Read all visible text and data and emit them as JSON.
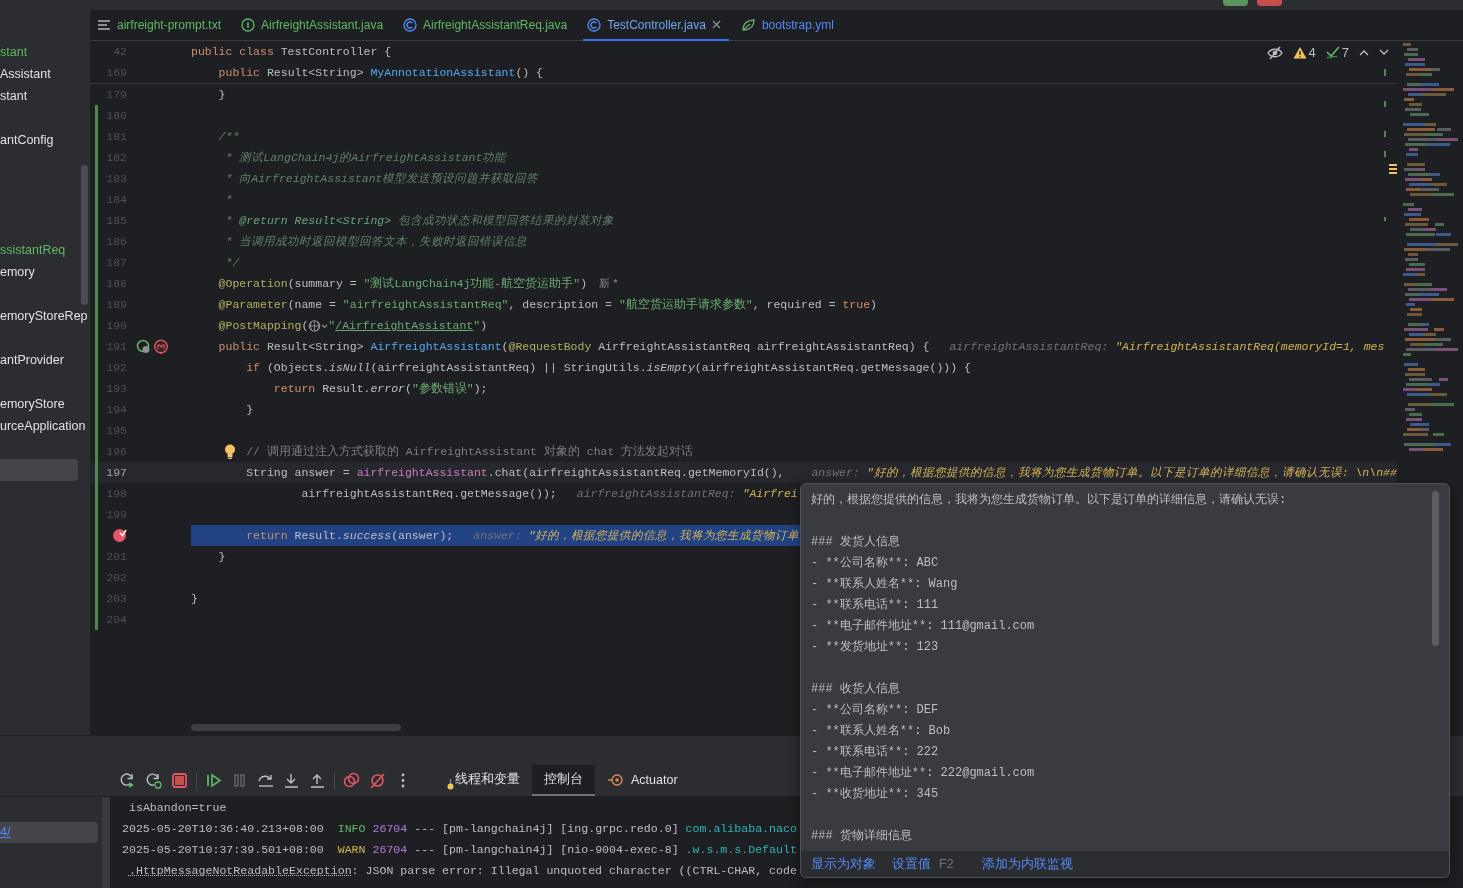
{
  "top_bar": {
    "buttons": [
      {
        "kind": "run"
      },
      {
        "kind": "stop"
      }
    ]
  },
  "project_tree": {
    "items": [
      {
        "label": "stant",
        "color": "#5fb865",
        "selected": false
      },
      {
        "label": "Assistant",
        "color": "#dfe1e5",
        "selected": false
      },
      {
        "label": "stant",
        "color": "#dfe1e5",
        "selected": false
      },
      {
        "selected": false
      },
      {
        "label": "antConfig",
        "color": "#dfe1e5",
        "selected": false
      },
      {
        "selected": false
      },
      {
        "selected": false
      },
      {
        "selected": false
      },
      {
        "selected": false
      },
      {
        "label": "ssistantReq",
        "color": "#5fb865",
        "selected": false
      },
      {
        "label": "emory",
        "color": "#dfe1e5",
        "selected": false
      },
      {
        "selected": false
      },
      {
        "label": "emoryStoreRep",
        "color": "#dfe1e5",
        "selected": false
      },
      {
        "selected": false
      },
      {
        "label": "antProvider",
        "color": "#dfe1e5",
        "selected": false
      },
      {
        "selected": false
      },
      {
        "label": "emoryStore",
        "color": "#dfe1e5",
        "selected": false
      },
      {
        "label": "urceApplication",
        "color": "#dfe1e5",
        "selected": false
      },
      {
        "selected": false
      },
      {
        "selected": true
      }
    ]
  },
  "editor": {
    "tabs": [
      {
        "label": "airfreight-prompt.txt",
        "kind": "text",
        "color": "#5fb865",
        "selected": false
      },
      {
        "label": "AirfreightAssistant.java",
        "kind": "interface",
        "color": "#5fb865",
        "selected": false
      },
      {
        "label": "AirfreightAssistantReq.java",
        "kind": "class",
        "color": "#5fb865",
        "selected": false
      },
      {
        "label": "TestController.java",
        "kind": "class",
        "color": "#6ea6f0",
        "selected": true
      },
      {
        "label": "bootstrap.yml",
        "kind": "yaml",
        "color": "#548af7",
        "selected": false
      }
    ],
    "inspections": {
      "warnings": "4",
      "checks": "7"
    },
    "sticky_lines": [
      {
        "number": "42",
        "tokens": [
          {
            "kind": "k",
            "text": "public class "
          },
          {
            "kind": "p",
            "text": "TestController {"
          }
        ]
      },
      {
        "number": "169",
        "tokens": [
          {
            "kind": "k",
            "text": "    public "
          },
          {
            "kind": "p",
            "text": "Result<String> "
          },
          {
            "kind": "f",
            "text": "MyAnnotationAssistant"
          },
          {
            "kind": "p",
            "text": "() {"
          }
        ]
      }
    ],
    "lines": [
      {
        "number": "179",
        "changed": false,
        "current": false,
        "highlighted": false,
        "tokens": [
          {
            "kind": "p",
            "text": "    }"
          }
        ]
      },
      {
        "number": "180",
        "changed": true,
        "current": false,
        "highlighted": false
      },
      {
        "number": "181",
        "changed": true,
        "current": false,
        "highlighted": false,
        "tokens": [
          {
            "kind": "d",
            "text": "    /**"
          }
        ]
      },
      {
        "number": "182",
        "changed": true,
        "current": false,
        "highlighted": false,
        "tokens": [
          {
            "kind": "d",
            "text": "     * 测试LangChain4j的AirfreightAssistant功能"
          }
        ]
      },
      {
        "number": "183",
        "changed": true,
        "current": false,
        "highlighted": false,
        "tokens": [
          {
            "kind": "d",
            "text": "     * 向AirfreightAssistant模型发送预设问题并获取回答"
          }
        ]
      },
      {
        "number": "184",
        "changed": true,
        "current": false,
        "highlighted": false,
        "tokens": [
          {
            "kind": "d",
            "text": "     *"
          }
        ]
      },
      {
        "number": "185",
        "changed": true,
        "current": false,
        "highlighted": false,
        "tokens": [
          {
            "kind": "d",
            "text": "     * "
          },
          {
            "kind": "dt",
            "text": "@return Result<String>"
          },
          {
            "kind": "d",
            "text": " 包含成功状态和模型回答结果的封装对象"
          }
        ]
      },
      {
        "number": "186",
        "changed": true,
        "current": false,
        "highlighted": false,
        "tokens": [
          {
            "kind": "d",
            "text": "     * 当调用成功时返回模型回答文本，失败时返回错误信息"
          }
        ]
      },
      {
        "number": "187",
        "changed": true,
        "current": false,
        "highlighted": false,
        "tokens": [
          {
            "kind": "d",
            "text": "     */"
          }
        ]
      },
      {
        "number": "188",
        "changed": true,
        "current": false,
        "highlighted": false,
        "tokens": [
          {
            "kind": "a",
            "text": "    @Operation"
          },
          {
            "kind": "p",
            "text": "(summary = "
          },
          {
            "kind": "s",
            "text": "\"测试LangChain4j功能-航空货运助手\""
          },
          {
            "kind": "p",
            "text": ")"
          }
        ],
        "inlay": "新 *"
      },
      {
        "number": "189",
        "changed": true,
        "current": false,
        "highlighted": false,
        "tokens": [
          {
            "kind": "a",
            "text": "    @Parameter"
          },
          {
            "kind": "p",
            "text": "(name = "
          },
          {
            "kind": "s",
            "text": "\"airfreightAssistantReq\""
          },
          {
            "kind": "p",
            "text": ", description = "
          },
          {
            "kind": "s",
            "text": "\"航空货运助手请求参数\""
          },
          {
            "kind": "p",
            "text": ", required = "
          },
          {
            "kind": "k",
            "text": "true"
          },
          {
            "kind": "p",
            "text": ")"
          }
        ]
      },
      {
        "number": "190",
        "changed": true,
        "current": false,
        "highlighted": false,
        "tokens": [
          {
            "kind": "a",
            "text": "    @PostMapping"
          },
          {
            "kind": "p",
            "text": "("
          },
          {
            "kind": "globe"
          },
          {
            "kind": "s",
            "text": "\""
          },
          {
            "kind": "u",
            "text": "/AirfreightAssistant"
          },
          {
            "kind": "s",
            "text": "\""
          },
          {
            "kind": "p",
            "text": ")"
          }
        ]
      },
      {
        "number": "191",
        "changed": true,
        "current": false,
        "highlighted": false,
        "markers": [
          {
            "kind": "bean"
          },
          {
            "kind": "mapping"
          }
        ],
        "tokens": [
          {
            "kind": "k",
            "text": "    public "
          },
          {
            "kind": "p",
            "text": "Result<String> "
          },
          {
            "kind": "f",
            "text": "AirfreightAssistant"
          },
          {
            "kind": "p",
            "text": "("
          },
          {
            "kind": "a",
            "text": "@RequestBody "
          },
          {
            "kind": "p",
            "text": "AirfreightAssistantReq airfreightAssistantReq) {"
          }
        ],
        "hint": {
          "name": "airfreightAssistantReq:",
          "value": "\"AirfreightAssistantReq(memoryId=1, mes"
        }
      },
      {
        "number": "192",
        "changed": true,
        "current": false,
        "highlighted": false,
        "tokens": [
          {
            "kind": "k",
            "text": "        if "
          },
          {
            "kind": "p",
            "text": "(Objects."
          },
          {
            "kind": "i",
            "text": "isNull"
          },
          {
            "kind": "p",
            "text": "(airfreightAssistantReq) || StringUtils."
          },
          {
            "kind": "i",
            "text": "isEmpty"
          },
          {
            "kind": "p",
            "text": "(airfreightAssistantReq.getMessage())) {"
          }
        ]
      },
      {
        "number": "193",
        "changed": true,
        "current": false,
        "highlighted": false,
        "tokens": [
          {
            "kind": "k",
            "text": "            return "
          },
          {
            "kind": "p",
            "text": "Result."
          },
          {
            "kind": "i",
            "text": "error"
          },
          {
            "kind": "p",
            "text": "("
          },
          {
            "kind": "s",
            "text": "\"参数错误\""
          },
          {
            "kind": "p",
            "text": ");"
          }
        ]
      },
      {
        "number": "194",
        "changed": true,
        "current": false,
        "highlighted": false,
        "tokens": [
          {
            "kind": "p",
            "text": "        }"
          }
        ]
      },
      {
        "number": "195",
        "changed": true,
        "current": false,
        "highlighted": false
      },
      {
        "number": "196",
        "changed": true,
        "current": false,
        "highlighted": false,
        "markers": [
          {
            "kind": "bulb"
          }
        ],
        "tokens": [
          {
            "kind": "c",
            "text": "        // 调用通过注入方式获取的 AirfreightAssistant 对象的 chat 方法发起对话"
          }
        ]
      },
      {
        "number": "197",
        "changed": true,
        "current": true,
        "highlighted": false,
        "tokens": [
          {
            "kind": "p",
            "text": "        String answer = "
          },
          {
            "kind": "fld",
            "text": "airfreightAssistant"
          },
          {
            "kind": "p",
            "text": ".chat(airfreightAssistantReq.getMemoryId(), "
          }
        ],
        "hint": {
          "name": "answer:",
          "value": "\"好的，根据您提供的信息，我将为您生成货物订单。以下是订单的详细信息，请确认无误: \\n\\n##"
        }
      },
      {
        "number": "198",
        "changed": true,
        "current": false,
        "highlighted": false,
        "tokens": [
          {
            "kind": "p",
            "text": "                airfreightAssistantReq.getMessage());"
          }
        ],
        "hint": {
          "name": "airfreightAssistantReq:",
          "value": "\"Airfrei"
        }
      },
      {
        "number": "199",
        "changed": true,
        "current": false,
        "highlighted": false
      },
      {
        "changed": true,
        "current": false,
        "highlighted": true,
        "markers": [
          {
            "kind": "breakpoint"
          }
        ],
        "tokens": [
          {
            "kind": "k",
            "text": "        return "
          },
          {
            "kind": "p",
            "text": "Result."
          },
          {
            "kind": "i",
            "text": "success"
          },
          {
            "kind": "p",
            "text": "(answer);"
          }
        ],
        "hint": {
          "name": "answer:",
          "value": "\"好的，根据您提供的信息，我将为您生成货物订单"
        }
      },
      {
        "number": "201",
        "changed": true,
        "current": false,
        "highlighted": false,
        "tokens": [
          {
            "kind": "p",
            "text": "    }"
          }
        ]
      },
      {
        "number": "202",
        "changed": true,
        "current": false,
        "highlighted": false
      },
      {
        "number": "203",
        "changed": true,
        "current": false,
        "highlighted": false,
        "tokens": [
          {
            "kind": "p",
            "text": "}"
          }
        ]
      },
      {
        "number": "204",
        "changed": true,
        "current": false,
        "highlighted": false
      }
    ]
  },
  "value_popup": {
    "paragraphs": [
      [
        "好的，根据您提供的信息，我将为您生成货物订单。以下是订单的详细信息，请确认无误:"
      ],
      [
        "### 发货人信息",
        "- **公司名称**: ABC",
        "- **联系人姓名**: Wang",
        "- **联系电话**: 111",
        "- **电子邮件地址**: 111@gmail.com",
        "- **发货地址**: 123"
      ],
      [
        "### 收货人信息",
        "- **公司名称**: DEF",
        "- **联系人姓名**: Bob",
        "- **联系电话**: 222",
        "- **电子邮件地址**: 222@gmail.com",
        "- **收货地址**: 345"
      ],
      [
        "### 货物详细信息"
      ]
    ],
    "actions": [
      {
        "label": "显示为对象"
      },
      {
        "label": "设置值",
        "shortcut": "F2"
      },
      {
        "label": "添加为内联监视"
      }
    ]
  },
  "debug_panel": {
    "toolbar": [
      [
        {
          "kind": "rerun"
        },
        {
          "kind": "rerun-debug"
        },
        {
          "kind": "stop"
        }
      ],
      [
        {
          "kind": "resume"
        },
        {
          "kind": "pause"
        },
        {
          "kind": "step-over"
        },
        {
          "kind": "step-into"
        },
        {
          "kind": "step-out"
        }
      ],
      [
        {
          "kind": "breakpoints"
        },
        {
          "kind": "mute-breakpoints"
        },
        {
          "kind": "more"
        }
      ]
    ],
    "tabs": [
      {
        "label": "线程和变量",
        "kind": "threads",
        "selected": false
      },
      {
        "label": "控制台",
        "kind": "console",
        "selected": true
      },
      {
        "label": "Actuator",
        "kind": "actuator",
        "selected": false
      }
    ],
    "side_items": [
      {
        "label": "4/",
        "selected": true
      }
    ],
    "console": [
      [
        {
          "kind": "p",
          "text": " isAbandon=true"
        }
      ],
      [
        {
          "kind": "p",
          "text": "2025-05-20T10:36:40.213+08:00  "
        },
        {
          "kind": "info",
          "text": "INFO "
        },
        {
          "kind": "pid",
          "text": "26704"
        },
        {
          "kind": "p",
          "text": " --- [pm-langchain4j] [ing.grpc.redo.0] "
        },
        {
          "kind": "logger",
          "text": "com.alibaba.naco"
        }
      ],
      [
        {
          "kind": "p",
          "text": "2025-05-20T10:37:39.501+08:00  "
        },
        {
          "kind": "warn",
          "text": "WARN "
        },
        {
          "kind": "pid",
          "text": "26704"
        },
        {
          "kind": "p",
          "text": " --- [pm-langchain4j] [nio-9004-exec-8] "
        },
        {
          "kind": "logger",
          "text": ".w.s.m.s.Default"
        }
      ],
      [
        {
          "kind": "ex",
          "text": " .HttpMessageNotReadableException"
        },
        {
          "kind": "p",
          "text": ": JSON parse error: Illegal unquoted character ((CTRL-CHAR, code"
        }
      ]
    ]
  }
}
